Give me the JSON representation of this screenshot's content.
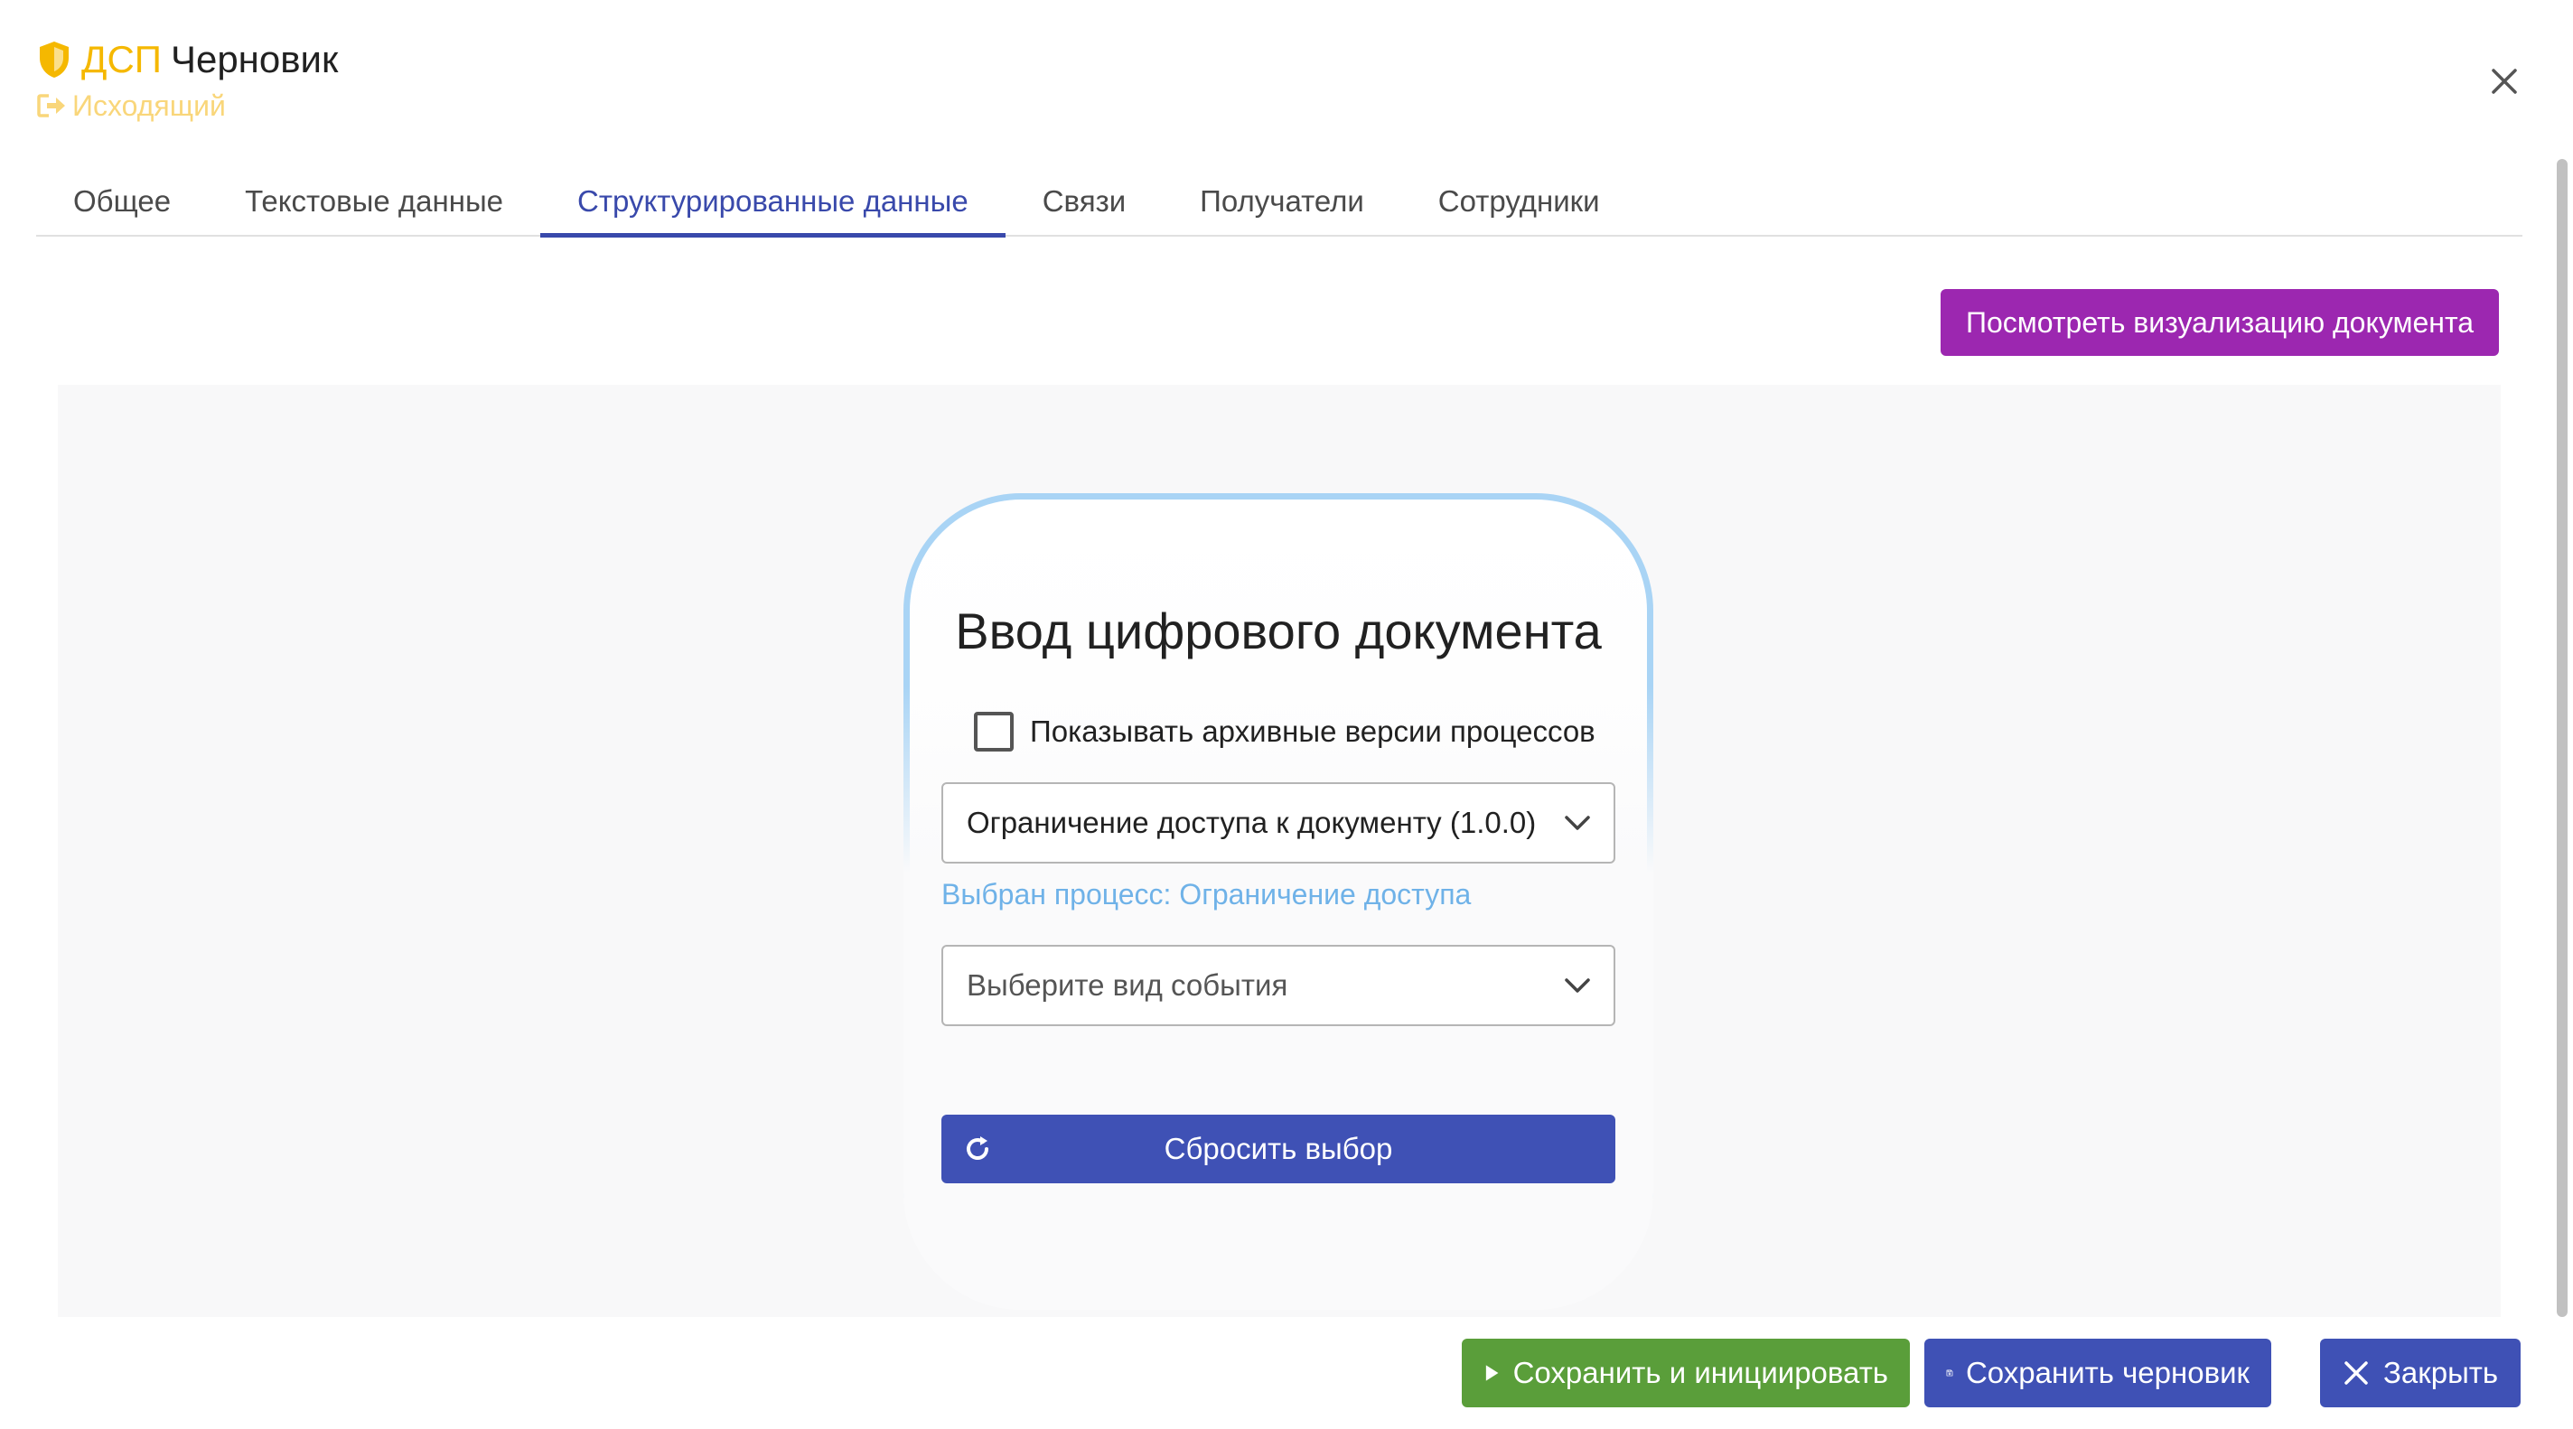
{
  "header": {
    "badge": "ДСП",
    "status": "Черновик",
    "direction": "Исходящий"
  },
  "tabs": [
    {
      "label": "Общее",
      "active": false
    },
    {
      "label": "Текстовые данные",
      "active": false
    },
    {
      "label": "Структурированные данные",
      "active": true
    },
    {
      "label": "Связи",
      "active": false
    },
    {
      "label": "Получатели",
      "active": false
    },
    {
      "label": "Сотрудники",
      "active": false
    }
  ],
  "toolbar": {
    "visualize_label": "Посмотреть визуализацию документа"
  },
  "form": {
    "title": "Ввод цифрового документа",
    "archive_label": "Показывать архивные версии процессов",
    "archive_checked": false,
    "process_value": "Ограничение доступа к документу (1.0.0)",
    "selected_process_hint": "Выбран процесс: Ограничение доступа",
    "event_placeholder": "Выберите вид события",
    "reset_label": "Сбросить выбор"
  },
  "footer": {
    "save_init_label": "Сохранить и инициировать",
    "save_draft_label": "Сохранить черновик",
    "close_label": "Закрыть"
  },
  "colors": {
    "accent": "#3f51b5",
    "tab_active": "#3949ab",
    "visualize": "#9c27b0",
    "green": "#5a9e3a",
    "badge": "#f5b800",
    "hint": "#6fb2e8"
  },
  "icons": [
    "shield-icon",
    "outgoing-icon",
    "close-icon",
    "chevron-down-icon",
    "refresh-icon",
    "play-icon",
    "save-icon"
  ]
}
